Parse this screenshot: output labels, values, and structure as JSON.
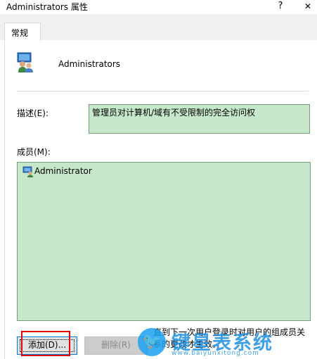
{
  "window": {
    "title": "Administrators 属性",
    "help_glyph": "?",
    "close_glyph": "✕"
  },
  "tabs": [
    {
      "label": "常规"
    }
  ],
  "group": {
    "name": "Administrators",
    "icon": "group-users-icon"
  },
  "description": {
    "label": "描述(E):",
    "value": "管理员对计算机/域有不受限制的完全访问权"
  },
  "members": {
    "label": "成员(M):",
    "items": [
      {
        "name": "Administrator",
        "icon": "user-icon"
      }
    ]
  },
  "note": "直到下一次用户登录时对用户的组成员关系的更改才生效。",
  "buttons": {
    "add": "添加(D)...",
    "remove": "删除(R)"
  },
  "watermark": {
    "text": "键星表系统",
    "url": "www.baiyunxitong.com"
  },
  "colors": {
    "field_bg": "#c7e7cb",
    "highlight_box": "#e00000",
    "watermark": "#1d8fe0"
  }
}
